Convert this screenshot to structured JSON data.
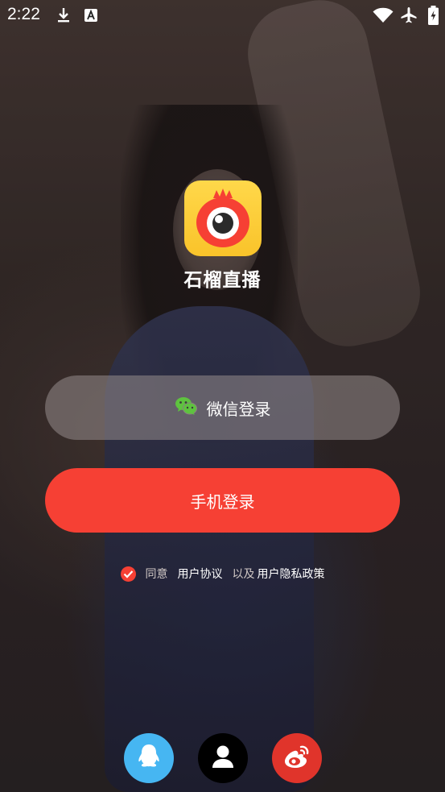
{
  "status_bar": {
    "time": "2:22",
    "icons": [
      "download-icon",
      "font-a-icon",
      "wifi-icon",
      "airplane-icon",
      "battery-charging-icon"
    ]
  },
  "app": {
    "name": "石榴直播",
    "logo_colors": {
      "background": "#f9c32a",
      "fruit": "#f64034"
    }
  },
  "buttons": {
    "wechat_label": "微信登录",
    "phone_label": "手机登录"
  },
  "agreement": {
    "prefix": "同意",
    "user_agreement": "用户协议",
    "connector": "以及",
    "privacy_policy": "用户隐私政策",
    "checked": true
  },
  "social": [
    {
      "name": "qq-icon",
      "color": "#46b6f2"
    },
    {
      "name": "contact-icon",
      "color": "#000000"
    },
    {
      "name": "weibo-icon",
      "color": "#e0342b"
    }
  ],
  "colors": {
    "accent": "#f64034"
  }
}
